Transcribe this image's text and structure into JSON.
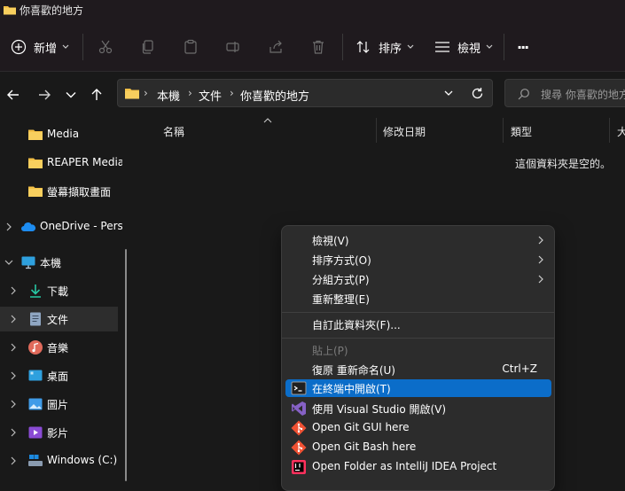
{
  "window": {
    "title": "你喜歡的地方"
  },
  "toolbar": {
    "new_label": "新增",
    "sort_label": "排序",
    "view_label": "檢視",
    "more_label": "···"
  },
  "breadcrumb": {
    "items": [
      "本機",
      "文件",
      "你喜歡的地方"
    ],
    "separator": "›"
  },
  "search": {
    "placeholder": "搜尋 你喜歡的地方"
  },
  "sidebar": {
    "items": [
      {
        "label": "Media",
        "icon": "folder-icon"
      },
      {
        "label": "REAPER Media",
        "icon": "folder-icon"
      },
      {
        "label": "螢幕擷取畫面",
        "icon": "folder-icon"
      },
      {
        "label": "OneDrive - Personal",
        "icon": "onedrive-icon"
      },
      {
        "label": "本機",
        "icon": "computer-icon"
      },
      {
        "label": "下載",
        "icon": "download-icon"
      },
      {
        "label": "文件",
        "icon": "documents-icon"
      },
      {
        "label": "音樂",
        "icon": "music-icon"
      },
      {
        "label": "桌面",
        "icon": "desktop-icon"
      },
      {
        "label": "圖片",
        "icon": "pictures-icon"
      },
      {
        "label": "影片",
        "icon": "videos-icon"
      },
      {
        "label": "Windows (C:)",
        "icon": "drive-icon"
      }
    ]
  },
  "columns": {
    "name": "名稱",
    "modified": "修改日期",
    "type": "類型",
    "size": "大"
  },
  "content": {
    "empty_message": "這個資料夾是空的。"
  },
  "context_menu": {
    "items": [
      {
        "label": "檢視(V)",
        "submenu": true
      },
      {
        "label": "排序方式(O)",
        "submenu": true
      },
      {
        "label": "分組方式(P)",
        "submenu": true
      },
      {
        "label": "重新整理(E)"
      },
      {
        "label": "自訂此資料夾(F)..."
      },
      {
        "label": "貼上(P)",
        "disabled": true
      },
      {
        "label": "復原 重新命名(U)",
        "shortcut": "Ctrl+Z"
      },
      {
        "label": "在終端中開啟(T)",
        "icon": "terminal-icon",
        "highlighted": true
      },
      {
        "label": "使用 Visual Studio 開啟(V)",
        "icon": "visual-studio-icon"
      },
      {
        "label": "Open Git GUI here",
        "icon": "git-icon"
      },
      {
        "label": "Open Git Bash here",
        "icon": "git-icon"
      },
      {
        "label": "Open Folder as IntelliJ IDEA Project",
        "icon": "intellij-icon"
      }
    ]
  },
  "colors": {
    "background": "#191919",
    "toolbar": "#1f1a1e",
    "folder": "#f4c046",
    "menu": "#2c2c2c",
    "highlight": "#0b6dc9"
  }
}
